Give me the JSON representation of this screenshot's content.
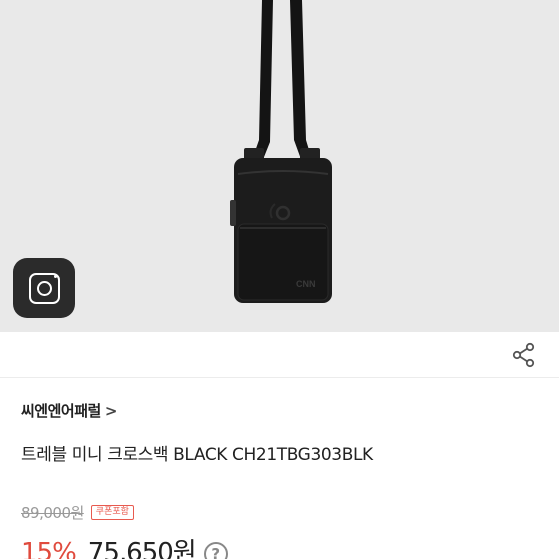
{
  "product": {
    "brand": "씨엔엔어패럴",
    "brand_chevron": ">",
    "title": "트레블 미니 크로스백 BLACK CH21TBG303BLK",
    "original_price": "89,000원",
    "coupon_badge": "쿠폰포함",
    "discount_rate": "15%",
    "sale_price": "75,650원",
    "help": "?"
  },
  "image": {
    "logo_text": "CNN"
  },
  "icons": {
    "camera": "camera-icon",
    "share": "share-icon",
    "help": "question-circle-icon"
  }
}
